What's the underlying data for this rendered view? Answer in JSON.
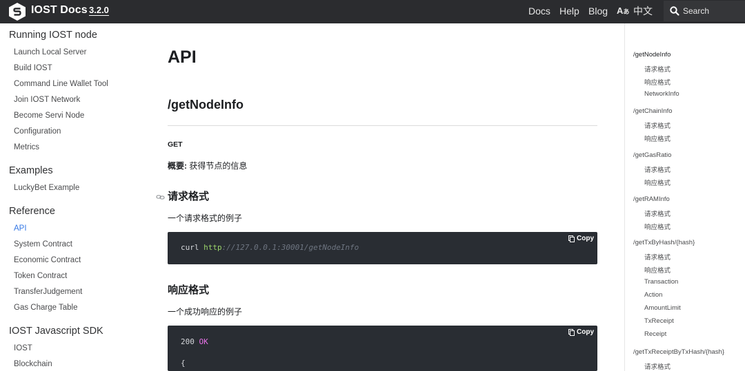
{
  "nav": {
    "brand": "IOST Docs",
    "version": "3.2.0",
    "links": [
      "Docs",
      "Help",
      "Blog"
    ],
    "lang_label": "中文",
    "search_placeholder": "Search",
    "bg": "#2b2c2f"
  },
  "sidebar": {
    "sections": [
      {
        "title": "Running IOST node",
        "items": [
          "Launch Local Server",
          "Build IOST",
          "Command Line Wallet Tool",
          "Join IOST Network",
          "Become Servi Node",
          "Configuration",
          "Metrics"
        ]
      },
      {
        "title": "Examples",
        "items": [
          "LuckyBet Example"
        ]
      },
      {
        "title": "Reference",
        "items": [
          "API",
          "System Contract",
          "Economic Contract",
          "Token Contract",
          "TransferJudgement",
          "Gas Charge Table"
        ]
      },
      {
        "title": "IOST Javascript SDK",
        "items": [
          "IOST",
          "Blockchain"
        ]
      }
    ],
    "active_item": "API",
    "accent": "#3578e5"
  },
  "main": {
    "title": "API",
    "endpoint": "/getNodeInfo",
    "method": "GET",
    "summary_label": "概要:",
    "summary_text": "获得节点的信息",
    "request_heading": "请求格式",
    "request_desc": "一个请求格式的例子",
    "request_code": {
      "cmd": "curl",
      "scheme": "http",
      "rest": "://127.0.0.1:30001/getNodeInfo"
    },
    "response_heading": "响应格式",
    "response_desc": "一个成功响应的例子",
    "response_code": {
      "status": "200",
      "status_text": "OK",
      "brace": "{"
    },
    "copy_label": "Copy",
    "code_bg": "#292d33"
  },
  "toc": [
    {
      "label": "/getNodeInfo",
      "level": 1
    },
    {
      "label": "请求格式",
      "level": 2
    },
    {
      "label": "响应格式",
      "level": 2
    },
    {
      "label": "NetworkInfo",
      "level": 2
    },
    {
      "label": "/getChainInfo",
      "level": 1
    },
    {
      "label": "请求格式",
      "level": 2
    },
    {
      "label": "响应格式",
      "level": 2
    },
    {
      "label": "/getGasRatio",
      "level": 1
    },
    {
      "label": "请求格式",
      "level": 2
    },
    {
      "label": "响应格式",
      "level": 2
    },
    {
      "label": "/getRAMInfo",
      "level": 1
    },
    {
      "label": "请求格式",
      "level": 2
    },
    {
      "label": "响应格式",
      "level": 2
    },
    {
      "label": "/getTxByHash/{hash}",
      "level": 1
    },
    {
      "label": "请求格式",
      "level": 2
    },
    {
      "label": "响应格式",
      "level": 2
    },
    {
      "label": "Transaction",
      "level": 2
    },
    {
      "label": "Action",
      "level": 2
    },
    {
      "label": "AmountLimit",
      "level": 2
    },
    {
      "label": "TxReceipt",
      "level": 2
    },
    {
      "label": "Receipt",
      "level": 2
    },
    {
      "label": "/getTxReceiptByTxHash/{hash}",
      "level": 1
    },
    {
      "label": "请求格式",
      "level": 2
    }
  ]
}
